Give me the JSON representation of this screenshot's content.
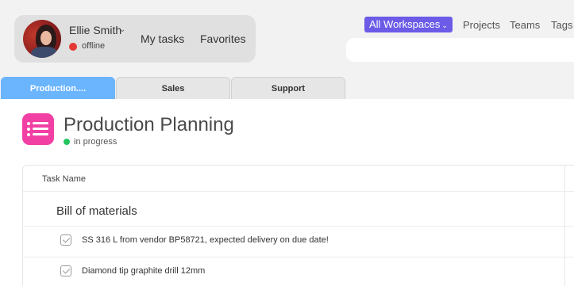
{
  "user": {
    "name": "Ellie Smith",
    "status": "offline",
    "status_color": "#e53935"
  },
  "nav": {
    "my_tasks": "My tasks",
    "favorites": "Favorites"
  },
  "topnav": {
    "workspace": "All Workspaces",
    "projects": "Projects",
    "teams": "Teams",
    "tags": "Tags"
  },
  "tabs": [
    {
      "label": "Production....",
      "active": true
    },
    {
      "label": "Sales",
      "active": false
    },
    {
      "label": "Support",
      "active": false
    }
  ],
  "project": {
    "title": "Production Planning",
    "status": "in progress",
    "icon_color": "#f23fa4",
    "status_color": "#22c55e"
  },
  "table": {
    "column_task_name": "Task Name",
    "section": "Bill of materials",
    "tasks": [
      "SS 316 L from vendor BP58721, expected delivery on due date!",
      "Diamond tip graphite drill 12mm"
    ]
  },
  "colors": {
    "accent": "#6b5be6",
    "active_tab": "#6bb5ff"
  }
}
